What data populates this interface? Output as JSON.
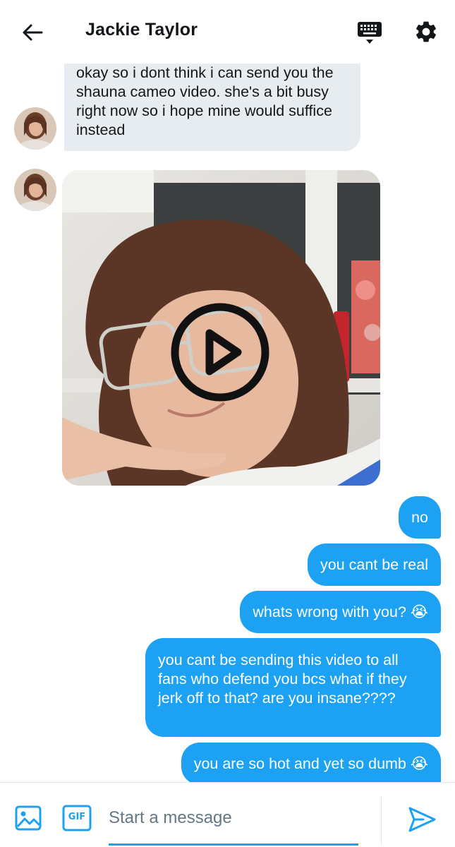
{
  "header": {
    "title": "Jackie Taylor",
    "back_icon": "arrow-left-icon",
    "keyboard_icon": "keyboard-icon",
    "settings_icon": "gear-icon"
  },
  "messages": {
    "incoming_text": "okay so i dont think i can send you the shauna cameo video. she's a bit busy right now so i hope mine would suffice instead",
    "video_play_icon": "play-icon",
    "outgoing": [
      "no",
      "you cant be real",
      "whats wrong with you? 😭",
      "you cant be sending this video to all fans who defend you bcs what if they jerk off to that? are you insane????",
      "you are so hot and yet so dumb 😭"
    ]
  },
  "composer": {
    "placeholder": "Start a message",
    "gif_label": "GIF",
    "image_icon": "image-icon",
    "send_icon": "send-icon"
  },
  "colors": {
    "accent": "#1da1f2",
    "incoming_bubble": "#e6ecf0",
    "text": "#14171a",
    "placeholder": "#657786"
  }
}
